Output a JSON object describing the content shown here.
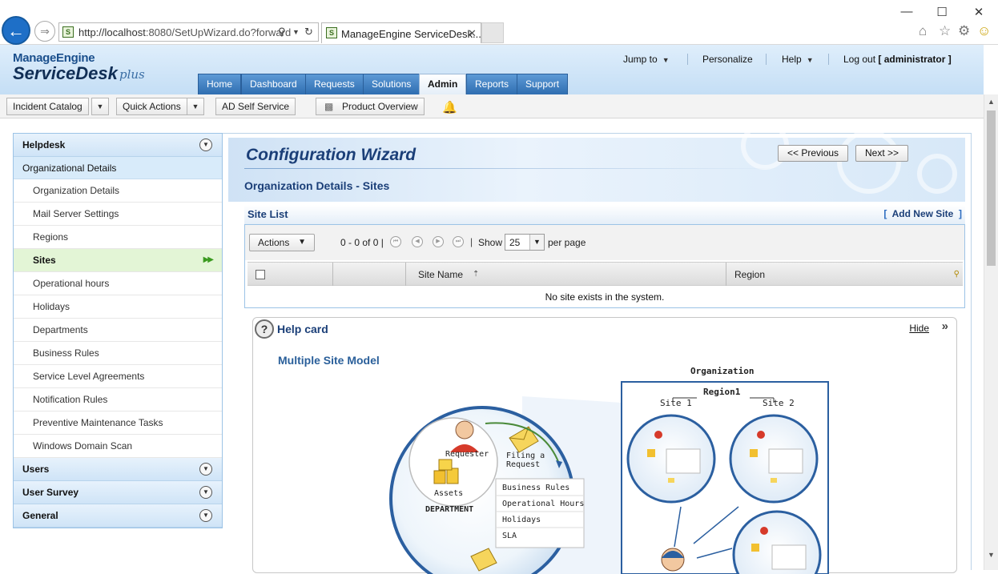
{
  "browser": {
    "window_controls": {
      "minimize": "—",
      "maximize": "☐",
      "close": "✕"
    },
    "address_prefix": "http://localhost",
    "address_rest": ":8080/SetUpWizard.do?forward",
    "tab_title": "ManageEngine ServiceDesk...",
    "tab_close": "✕"
  },
  "header": {
    "logo_top": "ManageEngine",
    "logo_main": "ServiceDesk",
    "logo_plus": "plus",
    "top_links": {
      "jump_to": "Jump to",
      "personalize": "Personalize",
      "help": "Help",
      "logout_prefix": "Log out",
      "user": "[ administrator ]"
    },
    "tabs": [
      "Home",
      "Dashboard",
      "Requests",
      "Solutions",
      "Admin",
      "Reports",
      "Support"
    ],
    "active_tab": "Admin"
  },
  "toolbar": {
    "incident_catalog": "Incident Catalog",
    "quick_actions": "Quick Actions",
    "ad_self_service": "AD Self Service",
    "product_overview": "Product Overview"
  },
  "sidebar": {
    "helpdesk": "Helpdesk",
    "org_details_header": "Organizational Details",
    "items": [
      "Organization Details",
      "Mail Server Settings",
      "Regions",
      "Sites",
      "Operational hours",
      "Holidays",
      "Departments",
      "Business Rules",
      "Service Level Agreements",
      "Notification Rules",
      "Preventive Maintenance Tasks",
      "Windows Domain Scan"
    ],
    "active_item": "Sites",
    "sections_below": [
      "Users",
      "User Survey",
      "General"
    ]
  },
  "wizard": {
    "title": "Configuration Wizard",
    "subtitle": "Organization Details -  Sites",
    "previous": "<< Previous",
    "next": "Next >>"
  },
  "site_list": {
    "title": "Site List",
    "add_new_open": "[",
    "add_new": "Add New Site",
    "add_new_close": "]",
    "actions": "Actions",
    "paging": "0 - 0 of 0 |",
    "paging_sep": "|",
    "show": "Show",
    "per_page_value": "25",
    "per_page": "per page",
    "columns": [
      "Site Name",
      "Region"
    ],
    "empty_message": "No site exists in the system."
  },
  "help_card": {
    "title": "Help card",
    "hide": "Hide",
    "heading": "Multiple Site Model",
    "diagram": {
      "requester": "Requester",
      "filing_line1": "Filing a",
      "filing_line2": "Request",
      "assets": "Assets",
      "department": "DEPARTMENT",
      "rules": [
        "Business Rules",
        "Operational Hours",
        "Holidays",
        "SLA"
      ],
      "organization": "Organization",
      "region": "Region1",
      "site1": "Site 1",
      "site2": "Site 2"
    }
  },
  "colors": {
    "nav_tab": "#3a7cc0",
    "title_blue": "#1b3f78",
    "active_sidebar": "#e3f5d6",
    "diagram_circle": "#2b5fa0"
  }
}
